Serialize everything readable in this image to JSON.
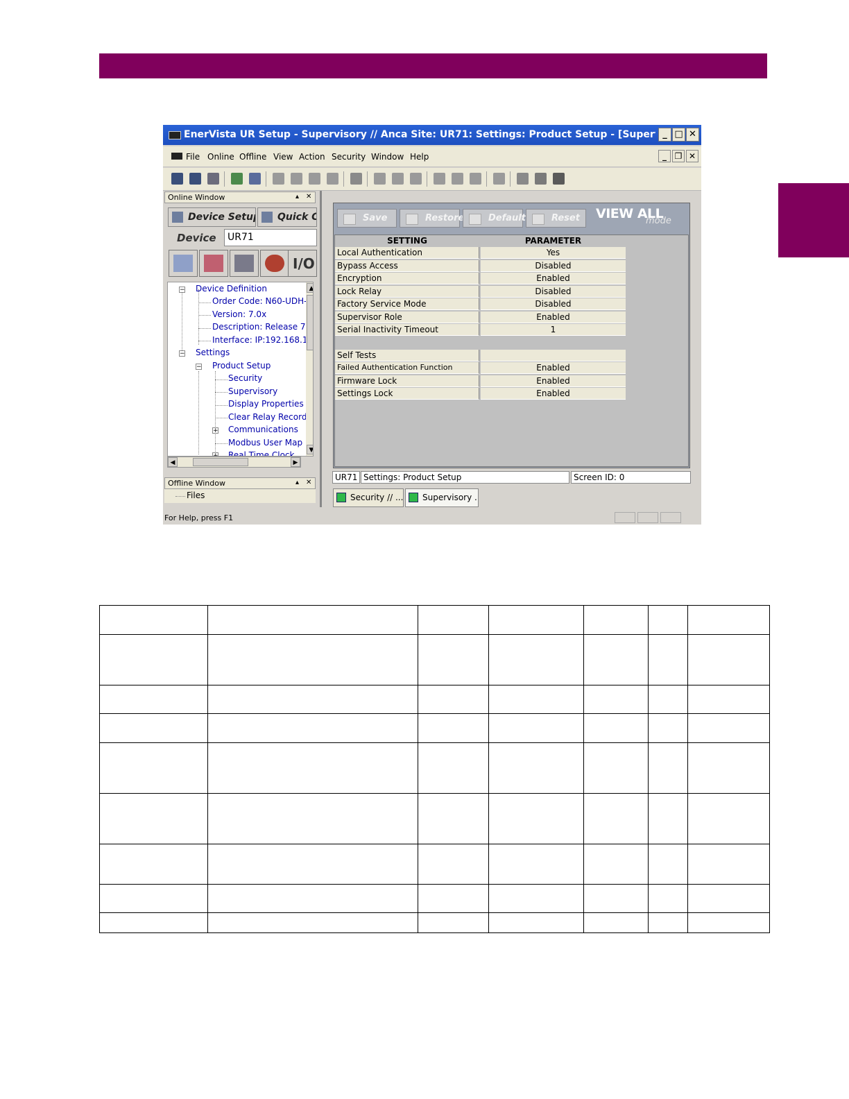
{
  "window": {
    "title": "EnerVista UR Setup  - Supervisory // Anca Site: UR71: Settings: Product Setup - [Supervisor...",
    "menu": [
      "File",
      "Online",
      "Offline",
      "View",
      "Action",
      "Security",
      "Window",
      "Help"
    ]
  },
  "left_panel": {
    "online_window_title": "Online Window",
    "tabs": [
      "Device Setup",
      "Quick Co"
    ],
    "device_label": "Device",
    "device_value": "UR71",
    "io_label": "I/O",
    "tree": [
      "Device Definition",
      "Order Code: N60-UDH-",
      "Version: 7.0x",
      "Description: Release 7",
      "Interface:  IP:192.168.1",
      "Settings",
      "Product Setup",
      "Security",
      "Supervisory",
      "Display Properties",
      "Clear Relay Record",
      "Communications",
      "Modbus User Map",
      "Real Time Clock"
    ],
    "offline_window_title": "Offline Window",
    "offline_files": "Files"
  },
  "status_bar": {
    "help_text": "For Help, press F1"
  },
  "right_panel": {
    "buttons": [
      "Save",
      "Restore",
      "Default",
      "Reset"
    ],
    "view_all": "VIEW ALL",
    "view_mode": "mode",
    "header": {
      "setting": "SETTING",
      "parameter": "PARAMETER"
    },
    "rows": [
      {
        "setting": "Local Authentication",
        "parameter": "Yes"
      },
      {
        "setting": "Bypass Access",
        "parameter": "Disabled"
      },
      {
        "setting": "Encryption",
        "parameter": "Enabled"
      },
      {
        "setting": "Lock Relay",
        "parameter": "Disabled"
      },
      {
        "setting": "Factory Service Mode",
        "parameter": "Disabled"
      },
      {
        "setting": "Supervisor Role",
        "parameter": "Enabled"
      },
      {
        "setting": "Serial Inactivity Timeout",
        "parameter": "1"
      }
    ],
    "rows2": [
      {
        "setting": "Self Tests",
        "parameter": ""
      },
      {
        "setting": "Failed Authentication Function",
        "parameter": "Enabled"
      },
      {
        "setting": "Firmware Lock",
        "parameter": "Enabled"
      },
      {
        "setting": "Settings Lock",
        "parameter": "Enabled"
      }
    ],
    "status": {
      "device": "UR71",
      "path": "Settings: Product Setup",
      "screen_id": "Screen ID: 0"
    },
    "window_tabs": [
      "Security // ...",
      "Supervisory ..."
    ]
  }
}
